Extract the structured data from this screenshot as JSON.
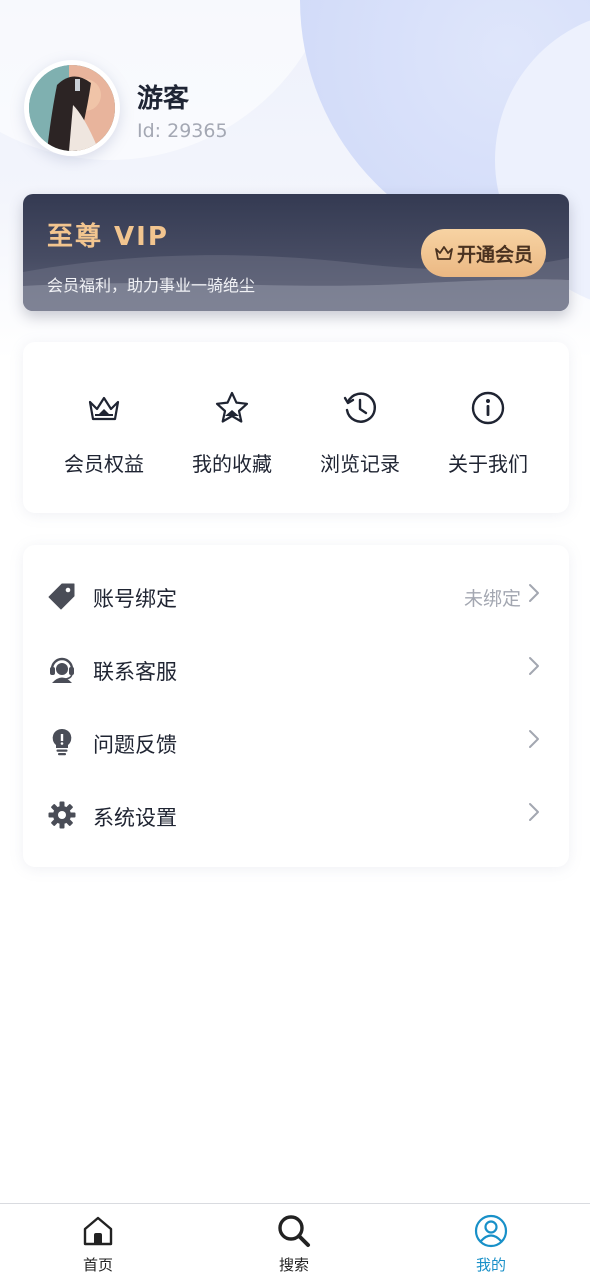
{
  "profile": {
    "name": "游客",
    "id_label": "Id: 29365"
  },
  "vip": {
    "title": "至尊 VIP",
    "subtitle": "会员福利，助力事业一骑绝尘",
    "button_label": "开通会员",
    "button_icon": "crown-icon"
  },
  "quick_actions": [
    {
      "label": "会员权益",
      "icon": "crown-icon"
    },
    {
      "label": "我的收藏",
      "icon": "star-icon"
    },
    {
      "label": "浏览记录",
      "icon": "history-clock-icon"
    },
    {
      "label": "关于我们",
      "icon": "info-icon"
    }
  ],
  "menu": [
    {
      "label": "账号绑定",
      "value": "未绑定",
      "icon": "tag-icon"
    },
    {
      "label": "联系客服",
      "value": "",
      "icon": "customer-service-icon"
    },
    {
      "label": "问题反馈",
      "value": "",
      "icon": "lightbulb-icon"
    },
    {
      "label": "系统设置",
      "value": "",
      "icon": "gear-icon"
    }
  ],
  "bottom_nav": [
    {
      "label": "首页",
      "icon": "home-icon",
      "active": false
    },
    {
      "label": "搜索",
      "icon": "search-icon",
      "active": false
    },
    {
      "label": "我的",
      "icon": "user-icon",
      "active": true
    }
  ],
  "colors": {
    "accent": "#1890c8",
    "vip_gold": "#f2c58f",
    "vip_card": "#343a52",
    "text_primary": "#1f2432",
    "text_secondary": "#a3a7b1"
  }
}
